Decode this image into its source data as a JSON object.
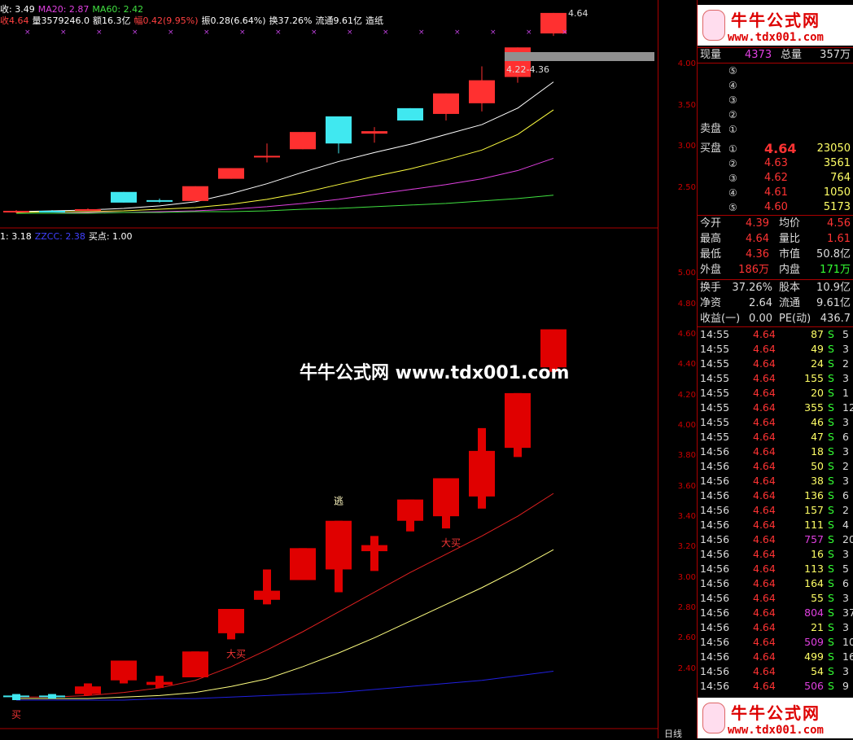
{
  "top_info": {
    "line1": [
      {
        "text": "收: 3.49",
        "color": "#ffffff"
      },
      {
        "text": "MA20: 2.87",
        "color": "#e040e0"
      },
      {
        "text": "MA60: 2.42",
        "color": "#40e040"
      }
    ],
    "line2": [
      {
        "text": "收4.64",
        "color": "#ff4040"
      },
      {
        "text": "量3579246.0",
        "color": "#ffffff"
      },
      {
        "text": "额16.3亿",
        "color": "#ffffff"
      },
      {
        "text": "幅0.42(9.95%)",
        "color": "#ff4040"
      },
      {
        "text": "振0.28(6.64%)",
        "color": "#ffffff"
      },
      {
        "text": "换37.26%",
        "color": "#ffffff"
      },
      {
        "text": "流通9.61亿",
        "color": "#ffffff"
      },
      {
        "text": "造纸",
        "color": "#ffffff"
      }
    ],
    "line3": [
      {
        "text": "1: 3.18",
        "color": "#ffffff"
      },
      {
        "text": "ZZCC: 2.38",
        "color": "#4040ff"
      },
      {
        "text": "买点: 1.00",
        "color": "#ffffff"
      }
    ]
  },
  "chart_data": [
    {
      "type": "candlestick",
      "panel": "main",
      "ylim": [
        2.2,
        4.5
      ],
      "yticks": [
        "4.00",
        "3.50",
        "3.00",
        "2.50"
      ],
      "candles": [
        {
          "o": 2.22,
          "h": 2.24,
          "l": 2.2,
          "c": 2.23
        },
        {
          "o": 2.23,
          "h": 2.24,
          "l": 2.21,
          "c": 2.22
        },
        {
          "o": 2.24,
          "h": 2.26,
          "l": 2.23,
          "c": 2.25
        },
        {
          "o": 2.46,
          "h": 2.46,
          "l": 2.33,
          "c": 2.33
        },
        {
          "o": 2.36,
          "h": 2.38,
          "l": 2.33,
          "c": 2.34
        },
        {
          "o": 2.35,
          "h": 2.53,
          "l": 2.35,
          "c": 2.53
        },
        {
          "o": 2.62,
          "h": 2.75,
          "l": 2.62,
          "c": 2.75
        },
        {
          "o": 2.88,
          "h": 3.05,
          "l": 2.82,
          "c": 2.9
        },
        {
          "o": 2.98,
          "h": 3.19,
          "l": 2.98,
          "c": 3.19
        },
        {
          "o": 3.38,
          "h": 3.38,
          "l": 2.93,
          "c": 3.05
        },
        {
          "o": 3.17,
          "h": 3.25,
          "l": 3.06,
          "c": 3.2
        },
        {
          "o": 3.48,
          "h": 3.48,
          "l": 3.33,
          "c": 3.33
        },
        {
          "o": 3.41,
          "h": 3.66,
          "l": 3.33,
          "c": 3.66
        },
        {
          "o": 3.54,
          "h": 3.99,
          "l": 3.44,
          "c": 3.82
        },
        {
          "o": 3.86,
          "h": 4.22,
          "l": 3.79,
          "c": 4.22
        },
        {
          "o": 4.39,
          "h": 4.64,
          "l": 4.36,
          "c": 4.64
        }
      ],
      "ma_lines": [
        {
          "name": "MA5",
          "color": "#ffffff",
          "values": [
            2.22,
            2.23,
            2.24,
            2.26,
            2.29,
            2.34,
            2.44,
            2.56,
            2.7,
            2.83,
            2.94,
            3.04,
            3.16,
            3.28,
            3.48,
            3.8
          ]
        },
        {
          "name": "MA10",
          "color": "#ffff40",
          "values": [
            2.21,
            2.22,
            2.22,
            2.23,
            2.25,
            2.27,
            2.31,
            2.37,
            2.45,
            2.55,
            2.65,
            2.74,
            2.85,
            2.97,
            3.16,
            3.46
          ]
        },
        {
          "name": "MA20",
          "color": "#e040e0",
          "values": [
            2.2,
            2.2,
            2.21,
            2.21,
            2.22,
            2.23,
            2.25,
            2.28,
            2.32,
            2.37,
            2.43,
            2.49,
            2.55,
            2.62,
            2.72,
            2.87
          ]
        },
        {
          "name": "MA60",
          "color": "#40e040",
          "values": [
            2.2,
            2.2,
            2.2,
            2.21,
            2.21,
            2.22,
            2.22,
            2.23,
            2.25,
            2.26,
            2.28,
            2.3,
            2.32,
            2.35,
            2.38,
            2.42
          ]
        }
      ],
      "annotations": [
        {
          "text": "4.64"
        },
        {
          "text": "4.22-4.36"
        }
      ]
    },
    {
      "type": "candlestick",
      "panel": "indicator",
      "ylim": [
        2.2,
        5.2
      ],
      "yticks": [
        "5.00",
        "4.80",
        "4.60",
        "4.40",
        "4.20",
        "4.00",
        "3.80",
        "3.60",
        "3.40",
        "3.20",
        "3.00",
        "2.80",
        "2.60",
        "2.40"
      ],
      "candles": [
        {
          "o": 2.22,
          "h": 2.24,
          "l": 2.2,
          "c": 2.23
        },
        {
          "o": 2.23,
          "h": 2.24,
          "l": 2.21,
          "c": 2.22
        },
        {
          "o": 2.24,
          "h": 2.31,
          "l": 2.23,
          "c": 2.29
        },
        {
          "o": 2.46,
          "h": 2.46,
          "l": 2.31,
          "c": 2.33
        },
        {
          "o": 2.32,
          "h": 2.36,
          "l": 2.28,
          "c": 2.3
        },
        {
          "o": 2.35,
          "h": 2.52,
          "l": 2.35,
          "c": 2.52
        },
        {
          "o": 2.8,
          "h": 2.8,
          "l": 2.6,
          "c": 2.64
        },
        {
          "o": 2.92,
          "h": 3.06,
          "l": 2.83,
          "c": 2.86
        },
        {
          "o": 2.99,
          "h": 3.2,
          "l": 2.99,
          "c": 3.2
        },
        {
          "o": 3.38,
          "h": 3.38,
          "l": 2.91,
          "c": 3.06
        },
        {
          "o": 3.18,
          "h": 3.28,
          "l": 3.05,
          "c": 3.22
        },
        {
          "o": 3.52,
          "h": 3.52,
          "l": 3.31,
          "c": 3.38
        },
        {
          "o": 3.41,
          "h": 3.66,
          "l": 3.33,
          "c": 3.66
        },
        {
          "o": 3.54,
          "h": 3.99,
          "l": 3.46,
          "c": 3.84
        },
        {
          "o": 3.86,
          "h": 4.22,
          "l": 3.8,
          "c": 4.22
        },
        {
          "o": 4.39,
          "h": 4.64,
          "l": 4.36,
          "c": 4.64
        }
      ],
      "lines": [
        {
          "color": "#e02020",
          "values": [
            2.22,
            2.22,
            2.23,
            2.25,
            2.28,
            2.33,
            2.42,
            2.53,
            2.65,
            2.78,
            2.91,
            3.04,
            3.16,
            3.28,
            3.41,
            3.56
          ]
        },
        {
          "color": "#ffff80",
          "values": [
            2.21,
            2.21,
            2.21,
            2.22,
            2.23,
            2.25,
            2.29,
            2.34,
            2.42,
            2.51,
            2.61,
            2.72,
            2.83,
            2.94,
            3.06,
            3.19
          ]
        },
        {
          "color": "#2020e0",
          "values": [
            2.2,
            2.2,
            2.2,
            2.2,
            2.21,
            2.21,
            2.22,
            2.23,
            2.24,
            2.25,
            2.27,
            2.29,
            2.31,
            2.33,
            2.36,
            2.39
          ]
        }
      ],
      "signals": [
        {
          "text": "买",
          "i": 0,
          "color": "#e33"
        },
        {
          "text": "大买",
          "i": 6,
          "color": "#e33"
        },
        {
          "text": "逃",
          "i": 9,
          "color": "#fff8c0"
        },
        {
          "text": "大买",
          "i": 12,
          "color": "#e33"
        }
      ]
    }
  ],
  "watermark": "牛牛公式网 www.tdx001.com",
  "bottom_axis_label": "日线",
  "logo": {
    "title": "牛牛公式网",
    "url": "www.tdx001.com"
  },
  "quote": {
    "now_vol_label": "现量",
    "now_vol": "4373",
    "total_vol_label": "总量",
    "total_vol": "357万",
    "sell_label": "卖盘",
    "buy_label": "买盘",
    "sell": [
      {
        "n": "⑤",
        "price": "",
        "vol": ""
      },
      {
        "n": "④",
        "price": "",
        "vol": ""
      },
      {
        "n": "③",
        "price": "",
        "vol": ""
      },
      {
        "n": "②",
        "price": "",
        "vol": ""
      },
      {
        "n": "①",
        "price": "",
        "vol": ""
      }
    ],
    "buy": [
      {
        "n": "①",
        "price": "4.64",
        "vol": "23050"
      },
      {
        "n": "②",
        "price": "4.63",
        "vol": "3561"
      },
      {
        "n": "③",
        "price": "4.62",
        "vol": "764"
      },
      {
        "n": "④",
        "price": "4.61",
        "vol": "1050"
      },
      {
        "n": "⑤",
        "price": "4.60",
        "vol": "5173"
      }
    ],
    "stats": [
      {
        "l1": "今开",
        "v1": "4.39",
        "c1": "#f33",
        "l2": "均价",
        "v2": "4.56",
        "c2": "#f33"
      },
      {
        "l1": "最高",
        "v1": "4.64",
        "c1": "#f33",
        "l2": "量比",
        "v2": "1.61",
        "c2": "#f33"
      },
      {
        "l1": "最低",
        "v1": "4.36",
        "c1": "#f33",
        "l2": "市值",
        "v2": "50.8亿",
        "c2": "#ddd"
      },
      {
        "l1": "外盘",
        "v1": "186万",
        "c1": "#f33",
        "l2": "内盘",
        "v2": "171万",
        "c2": "#3f3"
      }
    ],
    "stats2": [
      {
        "l1": "换手",
        "v1": "37.26%",
        "l2": "股本",
        "v2": "10.9亿"
      },
      {
        "l1": "净资",
        "v1": "2.64",
        "l2": "流通",
        "v2": "9.61亿"
      },
      {
        "l1": "收益(一)",
        "v1": "0.00",
        "l2": "PE(动)",
        "v2": "436.7"
      }
    ]
  },
  "ticks": [
    {
      "t": "14:55",
      "p": "4.64",
      "v": "87",
      "v_color": "#ff6",
      "s": "S",
      "n": "5"
    },
    {
      "t": "14:55",
      "p": "4.64",
      "v": "49",
      "v_color": "#ff6",
      "s": "S",
      "n": "3"
    },
    {
      "t": "14:55",
      "p": "4.64",
      "v": "24",
      "v_color": "#ff6",
      "s": "S",
      "n": "2"
    },
    {
      "t": "14:55",
      "p": "4.64",
      "v": "155",
      "v_color": "#ff6",
      "s": "S",
      "n": "3"
    },
    {
      "t": "14:55",
      "p": "4.64",
      "v": "20",
      "v_color": "#ff6",
      "s": "S",
      "n": "1"
    },
    {
      "t": "14:55",
      "p": "4.64",
      "v": "355",
      "v_color": "#ff6",
      "s": "S",
      "n": "12"
    },
    {
      "t": "14:55",
      "p": "4.64",
      "v": "46",
      "v_color": "#ff6",
      "s": "S",
      "n": "3"
    },
    {
      "t": "14:55",
      "p": "4.64",
      "v": "47",
      "v_color": "#ff6",
      "s": "S",
      "n": "6"
    },
    {
      "t": "14:56",
      "p": "4.64",
      "v": "18",
      "v_color": "#ff6",
      "s": "S",
      "n": "3"
    },
    {
      "t": "14:56",
      "p": "4.64",
      "v": "50",
      "v_color": "#ff6",
      "s": "S",
      "n": "2"
    },
    {
      "t": "14:56",
      "p": "4.64",
      "v": "38",
      "v_color": "#ff6",
      "s": "S",
      "n": "3"
    },
    {
      "t": "14:56",
      "p": "4.64",
      "v": "136",
      "v_color": "#ff6",
      "s": "S",
      "n": "6"
    },
    {
      "t": "14:56",
      "p": "4.64",
      "v": "157",
      "v_color": "#ff6",
      "s": "S",
      "n": "2"
    },
    {
      "t": "14:56",
      "p": "4.64",
      "v": "111",
      "v_color": "#ff6",
      "s": "S",
      "n": "4"
    },
    {
      "t": "14:56",
      "p": "4.64",
      "v": "757",
      "v_color": "#e040e0",
      "s": "S",
      "n": "20"
    },
    {
      "t": "14:56",
      "p": "4.64",
      "v": "16",
      "v_color": "#ff6",
      "s": "S",
      "n": "3"
    },
    {
      "t": "14:56",
      "p": "4.64",
      "v": "113",
      "v_color": "#ff6",
      "s": "S",
      "n": "5"
    },
    {
      "t": "14:56",
      "p": "4.64",
      "v": "164",
      "v_color": "#ff6",
      "s": "S",
      "n": "6"
    },
    {
      "t": "14:56",
      "p": "4.64",
      "v": "55",
      "v_color": "#ff6",
      "s": "S",
      "n": "3"
    },
    {
      "t": "14:56",
      "p": "4.64",
      "v": "804",
      "v_color": "#e040e0",
      "s": "S",
      "n": "37"
    },
    {
      "t": "14:56",
      "p": "4.64",
      "v": "21",
      "v_color": "#ff6",
      "s": "S",
      "n": "3"
    },
    {
      "t": "14:56",
      "p": "4.64",
      "v": "509",
      "v_color": "#e040e0",
      "s": "S",
      "n": "10"
    },
    {
      "t": "14:56",
      "p": "4.64",
      "v": "499",
      "v_color": "#ff6",
      "s": "S",
      "n": "16"
    },
    {
      "t": "14:56",
      "p": "4.64",
      "v": "54",
      "v_color": "#ff6",
      "s": "S",
      "n": "3"
    },
    {
      "t": "14:56",
      "p": "4.64",
      "v": "506",
      "v_color": "#e040e0",
      "s": "S",
      "n": "9"
    }
  ]
}
